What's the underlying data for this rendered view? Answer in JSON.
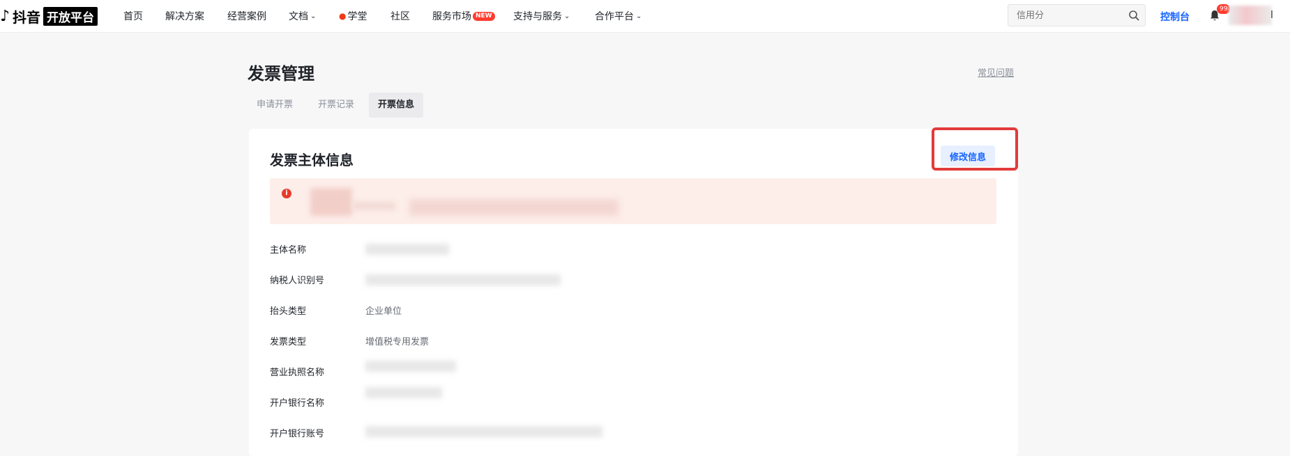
{
  "header": {
    "logo_brand": "抖音",
    "logo_platform": "开放平台",
    "nav": [
      {
        "label": "首页"
      },
      {
        "label": "解决方案"
      },
      {
        "label": "经营案例"
      },
      {
        "label": "文档"
      },
      {
        "label": "学堂"
      },
      {
        "label": "社区"
      },
      {
        "label": "服务市场"
      },
      {
        "label": "支持与服务"
      },
      {
        "label": "合作平台"
      }
    ],
    "new_badge": "NEW",
    "search_placeholder": "信用分",
    "console": "控制台",
    "notification_count": "99",
    "user_initial": "l"
  },
  "page": {
    "title": "发票管理",
    "faq_link": "常见问题",
    "tabs": [
      "申请开票",
      "开票记录",
      "开票信息"
    ],
    "active_tab": 2
  },
  "card": {
    "title": "发票主体信息",
    "edit_button": "修改信息",
    "fields": [
      {
        "label": "主体名称",
        "value": ""
      },
      {
        "label": "纳税人识别号",
        "value": ""
      },
      {
        "label": "抬头类型",
        "value": "企业单位"
      },
      {
        "label": "发票类型",
        "value": "增值税专用发票"
      },
      {
        "label": "营业执照名称",
        "value": ""
      },
      {
        "label": "开户银行名称",
        "value": ""
      },
      {
        "label": "开户银行账号",
        "value": ""
      }
    ]
  },
  "colors": {
    "accent": "#1664ff",
    "highlight_border": "#e23b3b",
    "alert_bg": "#fdeeea",
    "alert_icon": "#e63c2c"
  }
}
